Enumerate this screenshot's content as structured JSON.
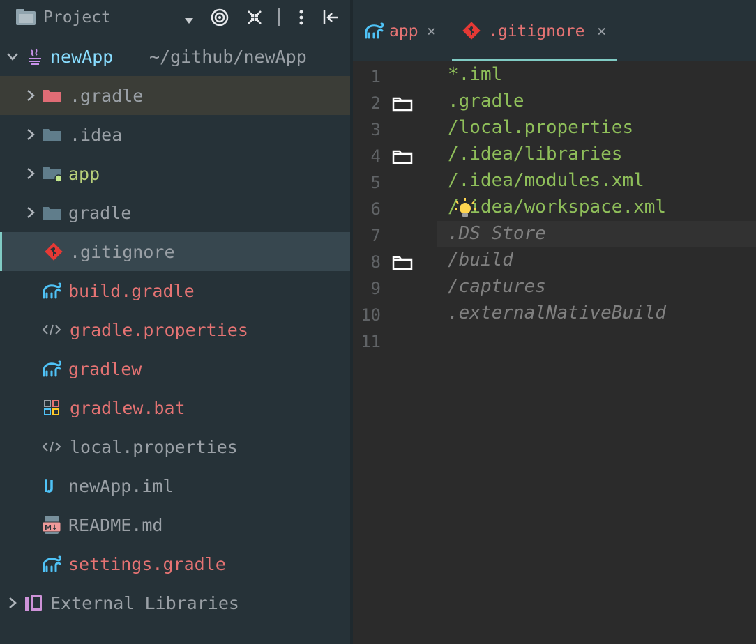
{
  "project_panel": {
    "title": "Project",
    "root": {
      "name": "newApp",
      "path": "~/github/newApp"
    },
    "items": [
      {
        "label": ".gradle",
        "icon": "folder-icon",
        "color": "#9aa0a6",
        "expandable": true
      },
      {
        "label": ".idea",
        "icon": "folder-icon",
        "color": "#9aa0a6",
        "expandable": true
      },
      {
        "label": "app",
        "icon": "module-folder-icon",
        "color": "#b7d07a",
        "expandable": true
      },
      {
        "label": "gradle",
        "icon": "folder-icon",
        "color": "#9aa0a6",
        "expandable": true
      },
      {
        "label": ".gitignore",
        "icon": "git-icon",
        "color": "#9aa0a6",
        "expandable": false
      },
      {
        "label": "build.gradle",
        "icon": "gradle-icon",
        "color": "#e57373",
        "expandable": false
      },
      {
        "label": "gradle.properties",
        "icon": "properties-icon",
        "color": "#e57373",
        "expandable": false
      },
      {
        "label": "gradlew",
        "icon": "gradle-icon",
        "color": "#e57373",
        "expandable": false
      },
      {
        "label": "gradlew.bat",
        "icon": "bat-file-icon",
        "color": "#e57373",
        "expandable": false
      },
      {
        "label": "local.properties",
        "icon": "properties-icon",
        "color": "#9aa0a6",
        "expandable": false
      },
      {
        "label": "newApp.iml",
        "icon": "iml-icon",
        "color": "#9aa0a6",
        "expandable": false
      },
      {
        "label": "README.md",
        "icon": "markdown-icon",
        "color": "#9aa0a6",
        "expandable": false
      },
      {
        "label": "settings.gradle",
        "icon": "gradle-icon",
        "color": "#e57373",
        "expandable": false
      }
    ],
    "external": "External Libraries"
  },
  "tabs": [
    {
      "label": "app",
      "close": "×",
      "icon": "gradle-icon",
      "color": "#e57373",
      "active": false
    },
    {
      "label": ".gitignore",
      "close": "×",
      "icon": "git-icon",
      "color": "#e57373",
      "active": true
    }
  ],
  "editor": {
    "lines": [
      {
        "num": "1",
        "text": "*.iml",
        "style": "green",
        "fold": false
      },
      {
        "num": "2",
        "text": ".gradle",
        "style": "green",
        "fold": true
      },
      {
        "num": "3",
        "text": "/local.properties",
        "style": "green",
        "fold": false
      },
      {
        "num": "4",
        "text": "/.idea/libraries",
        "style": "green",
        "fold": true
      },
      {
        "num": "5",
        "text": "/.idea/modules.xml",
        "style": "green",
        "fold": false
      },
      {
        "num": "6",
        "text": "/.idea/workspace.xml",
        "style": "green",
        "fold": false
      },
      {
        "num": "7",
        "text": ".DS_Store",
        "style": "comment",
        "fold": false
      },
      {
        "num": "8",
        "text": "/build",
        "style": "comment",
        "fold": true
      },
      {
        "num": "9",
        "text": "/captures",
        "style": "comment",
        "fold": false
      },
      {
        "num": "10",
        "text": ".externalNativeBuild",
        "style": "comment",
        "fold": false
      },
      {
        "num": "11",
        "text": "",
        "style": "comment",
        "fold": false
      }
    ]
  }
}
